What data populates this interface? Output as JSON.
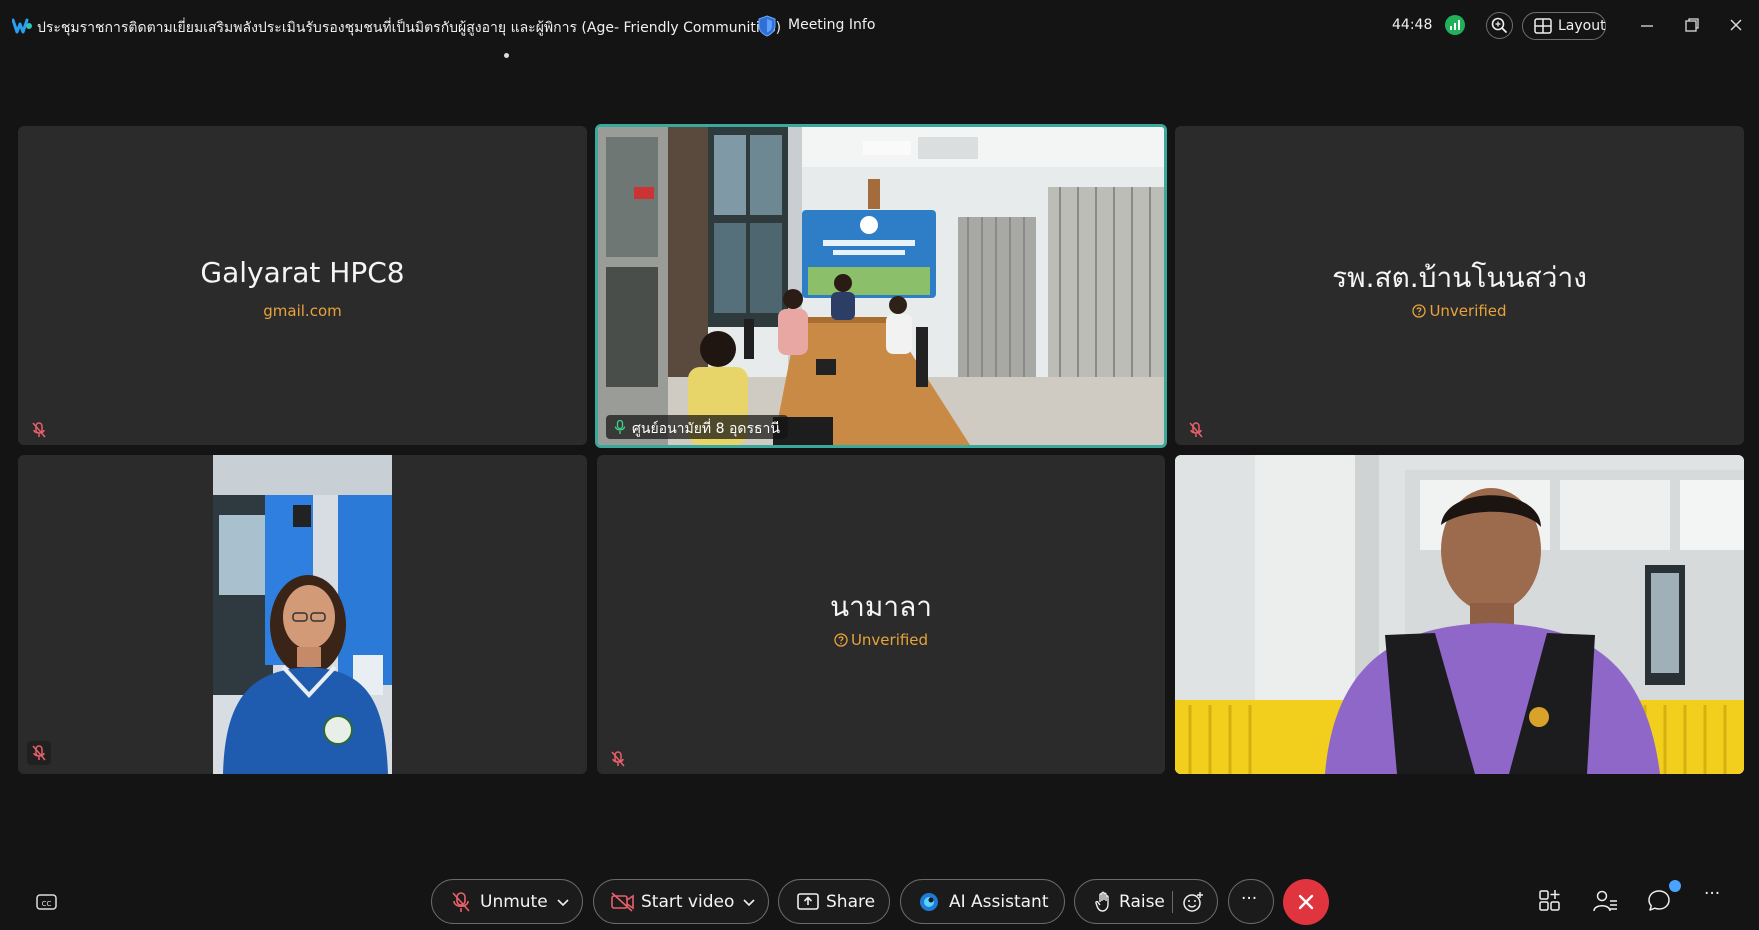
{
  "app": {
    "accent": "#3aa89b",
    "warning_color": "#e8a33a",
    "end_color": "#e0343f"
  },
  "titlebar": {
    "meeting_title": "ประชุมราชการติดตามเยี่ยมเสริมพลังประเมินรับรองชุมชนที่เป็นมิตรกับผู้สูงอายุ  และผู้พิการ (Age- Friendly Communities)",
    "meeting_info": "Meeting Info",
    "timer": "44:48",
    "layout_label": "Layout",
    "icons": [
      "app-logo-icon",
      "shield-icon",
      "signal-icon",
      "zoom-icon",
      "layout-grid-icon",
      "minimize-icon",
      "restore-icon",
      "close-icon"
    ]
  },
  "tiles": [
    {
      "name": "Galyarat HPC8",
      "subtitle": "gmail.com",
      "muted": true
    },
    {
      "name": "ศูนย์อนามัยที่ 8 อุดรธานี",
      "active_speaker": true,
      "video": true
    },
    {
      "name": "รพ.สต.บ้านโนนสว่าง",
      "subtitle": "Unverified",
      "muted": true
    },
    {
      "video": true,
      "muted": true
    },
    {
      "name": "นามาลา",
      "subtitle": "Unverified",
      "muted": true
    },
    {
      "video": true
    }
  ],
  "toolbar": {
    "unmute_label": "Unmute",
    "start_video_label": "Start video",
    "share_label": "Share",
    "ai_assistant_label": "AI Assistant",
    "raise_label": "Raise",
    "more_label": "···",
    "overflow_label": "···",
    "icons": [
      "captions-icon",
      "mic-off-icon",
      "camera-off-icon",
      "share-icon",
      "ai-assistant-icon",
      "hand-icon",
      "reaction-icon",
      "end-call-icon",
      "apps-icon",
      "participants-icon",
      "chat-icon"
    ]
  }
}
